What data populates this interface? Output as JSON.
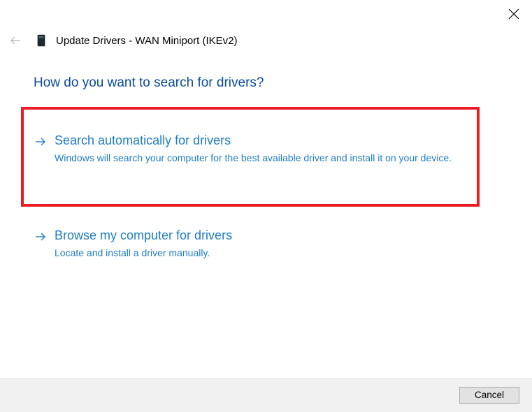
{
  "window": {
    "title_prefix": "Update Drivers - ",
    "device": "WAN Miniport (IKEv2)"
  },
  "heading": "How do you want to search for drivers?",
  "options": [
    {
      "title": "Search automatically for drivers",
      "description": "Windows will search your computer for the best available driver and install it on your device."
    },
    {
      "title": "Browse my computer for drivers",
      "description": "Locate and install a driver manually."
    }
  ],
  "footer": {
    "cancel_label": "Cancel"
  }
}
